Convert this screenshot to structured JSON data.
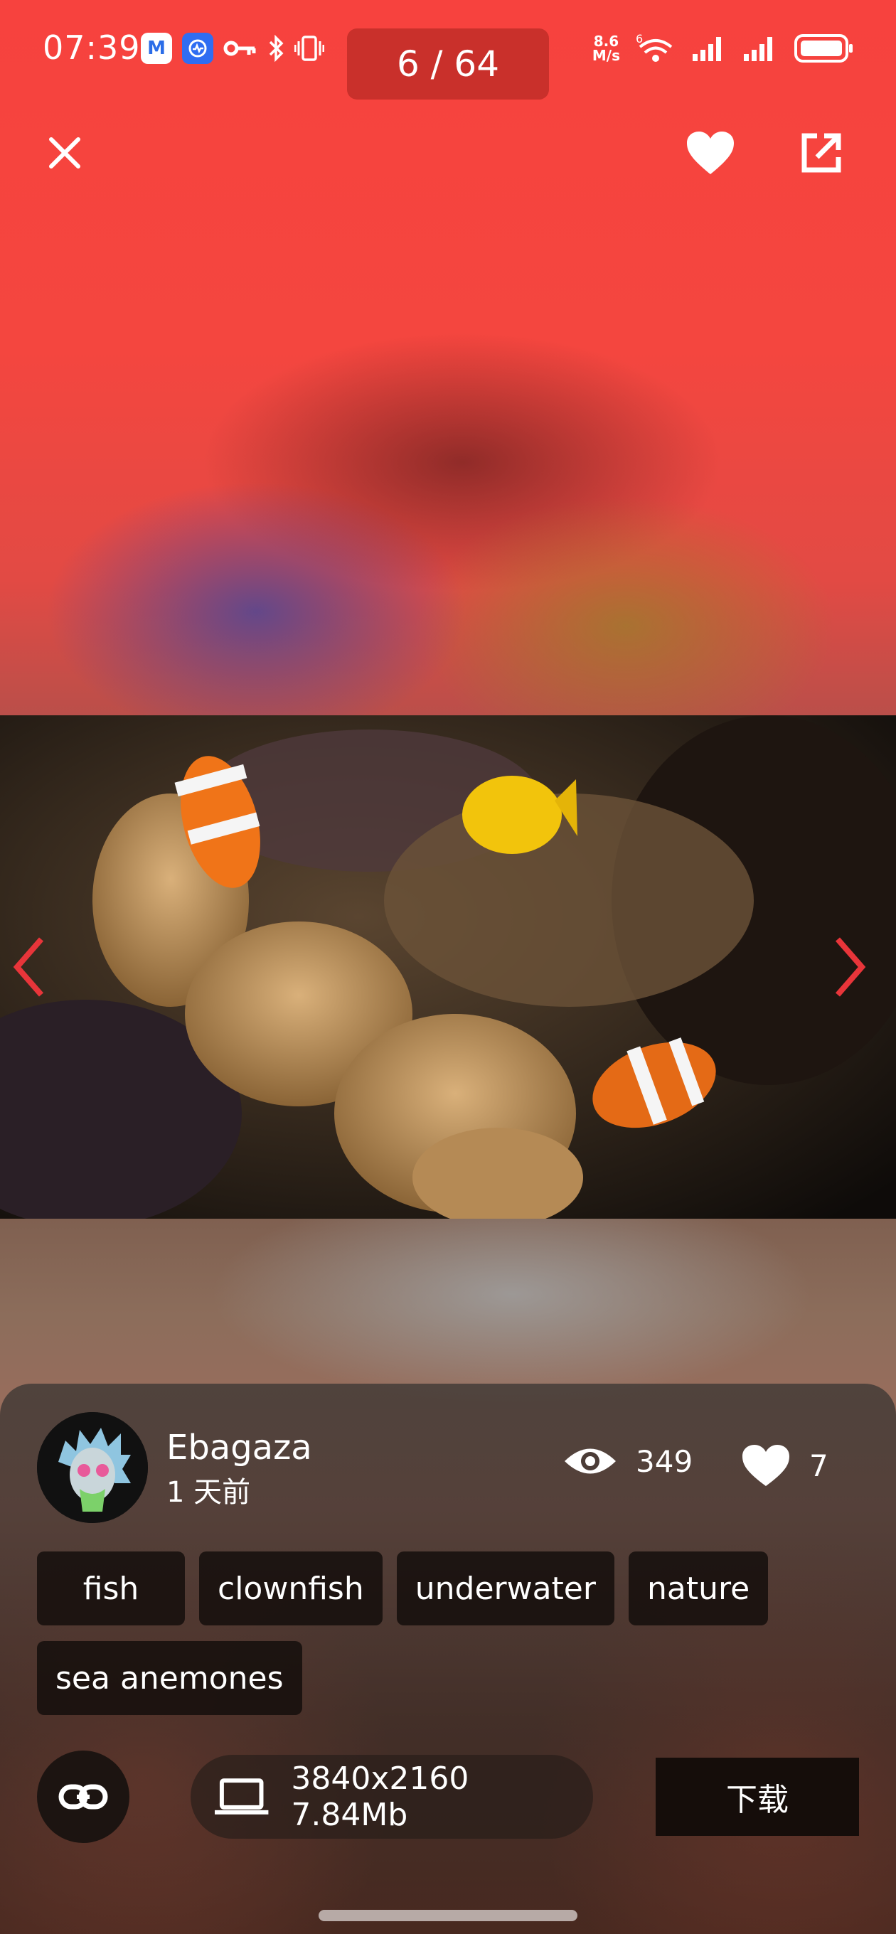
{
  "status_bar": {
    "time": "07:39",
    "net_speed": "8.6",
    "net_unit": "M/s",
    "wifi_label": "6",
    "battery": "full"
  },
  "viewer": {
    "counter": "6 / 64",
    "close_icon": "close-icon",
    "favorite_icon": "heart-icon",
    "share_icon": "open-external-icon",
    "prev_icon": "chevron-left-icon",
    "next_icon": "chevron-right-icon",
    "accent": "#e8353a"
  },
  "details": {
    "author": "Ebagaza",
    "posted": "1 天前",
    "views": "349",
    "likes": "7",
    "tags": [
      "fish",
      "clownfish",
      "underwater",
      "nature",
      "sea anemones"
    ],
    "resolution_size": "3840x2160 7.84Mb",
    "download_label": "下载"
  }
}
